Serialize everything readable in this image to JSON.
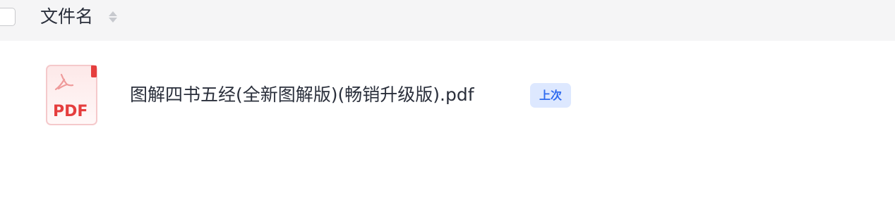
{
  "header": {
    "title": "文件名",
    "sort_icon": "sort-icon",
    "checkbox_checked": false
  },
  "files": [
    {
      "name": "图解四书五经(全新图解版)(畅销升级版).pdf",
      "type_label": "PDF",
      "icon": "pdf-file-icon",
      "badge": "上次"
    }
  ],
  "colors": {
    "header_bg": "#f5f5f6",
    "text": "#2a2f3b",
    "pdf_red": "#e53e3e",
    "badge_bg": "#dde8ff",
    "badge_text": "#2f6bef"
  }
}
